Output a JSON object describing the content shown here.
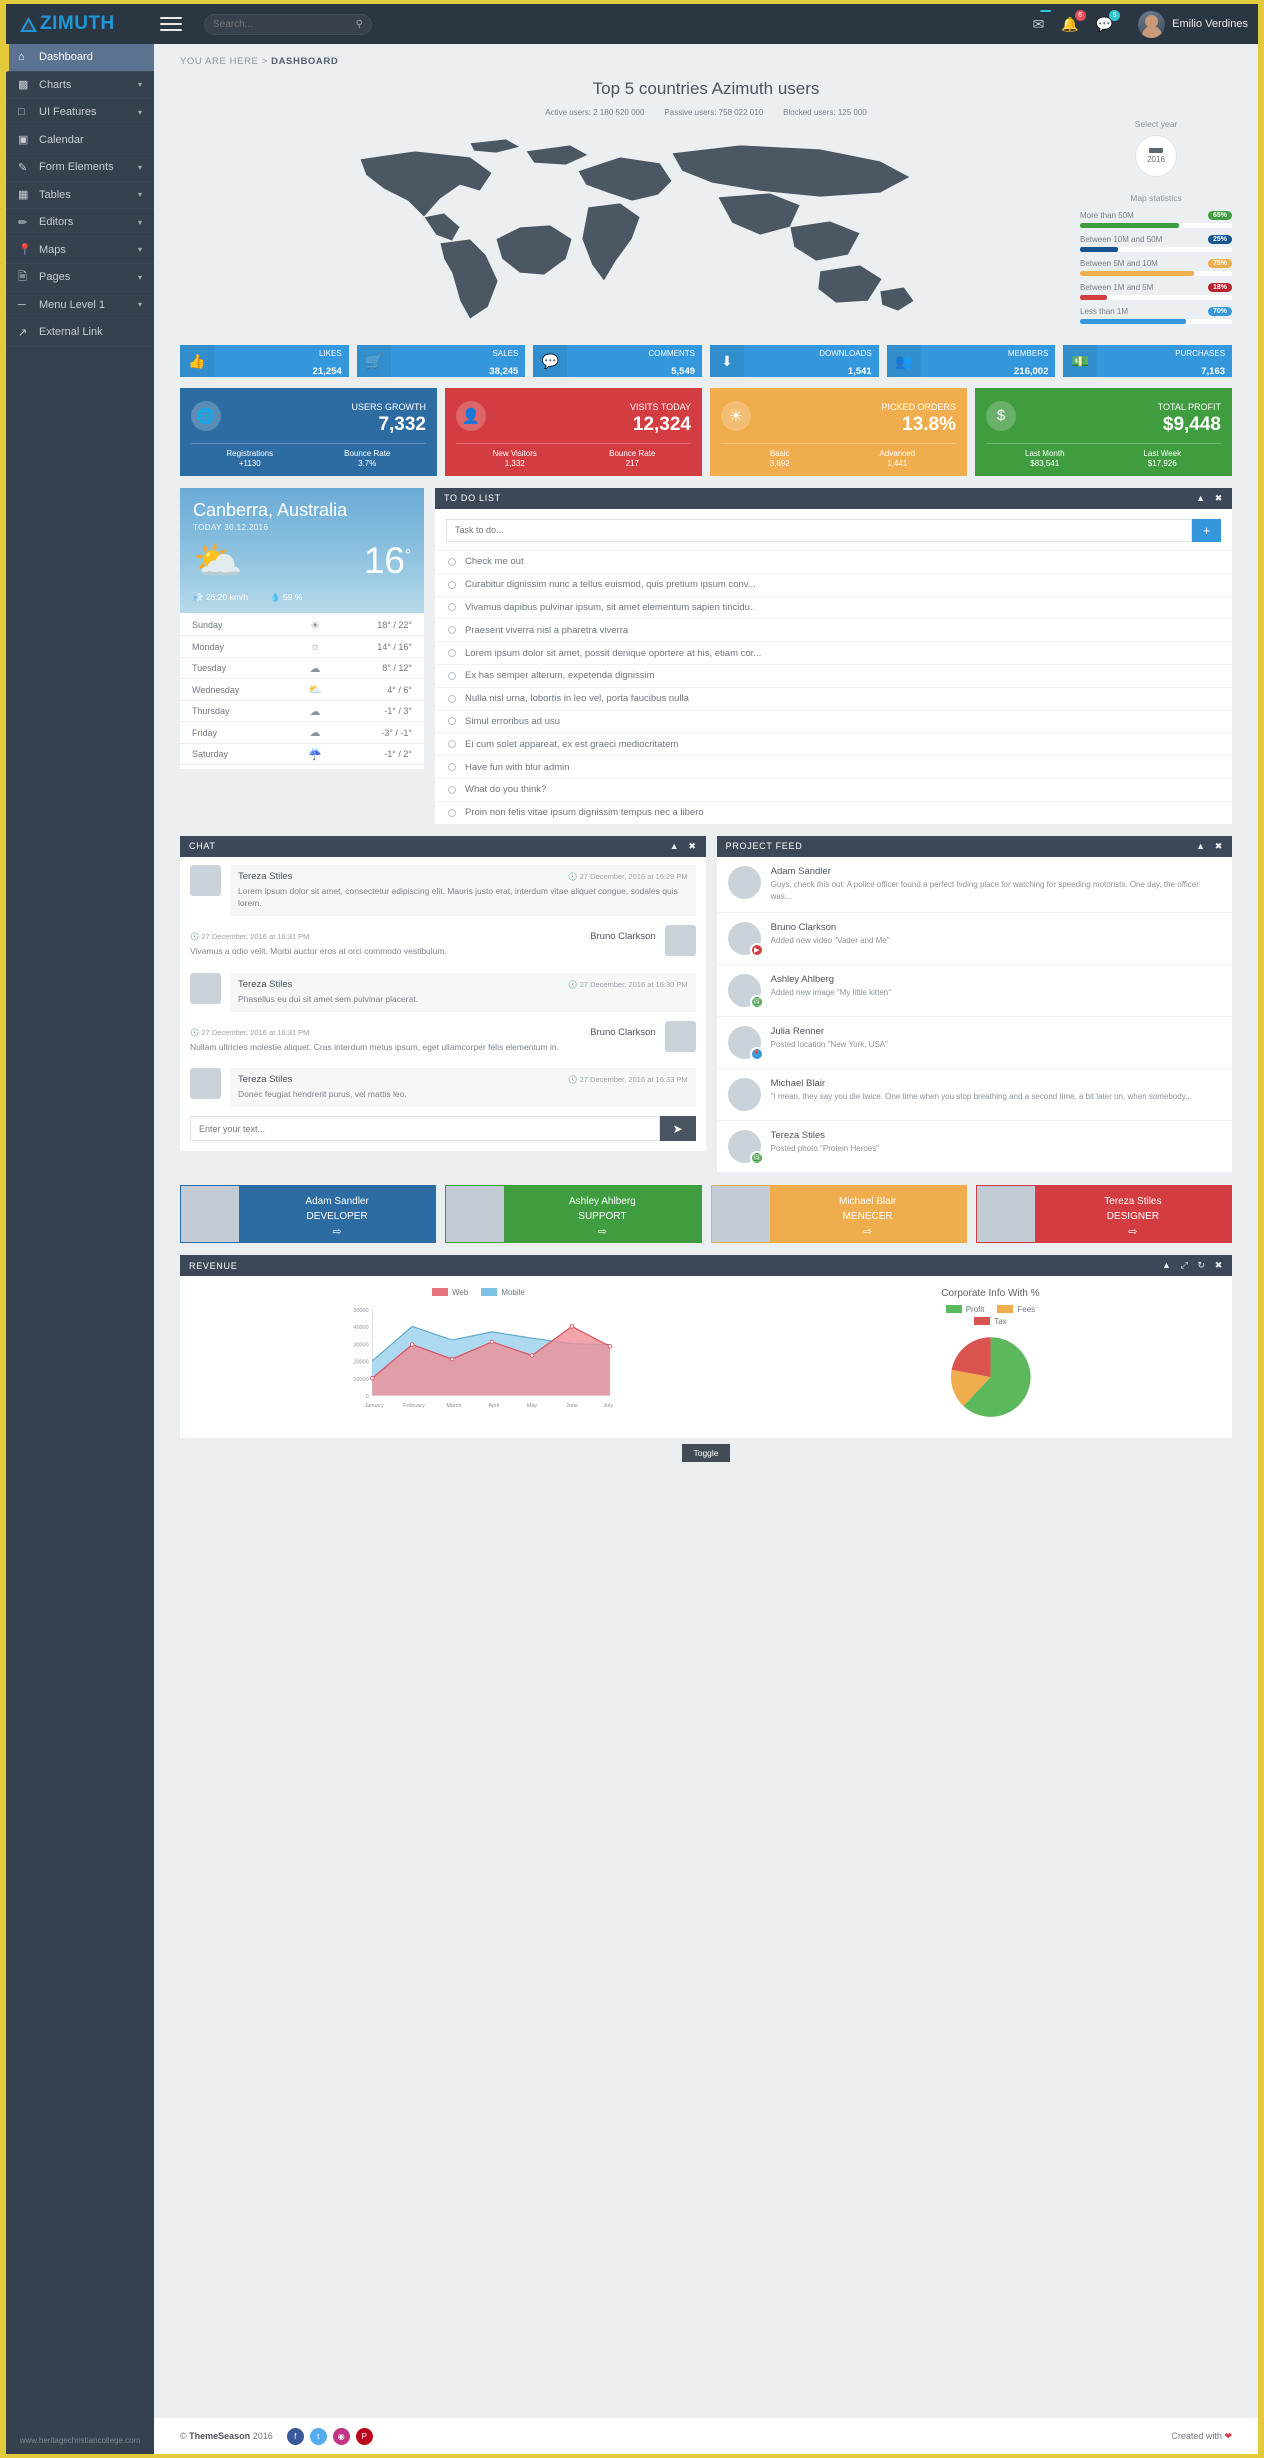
{
  "topbar": {
    "logo_text": "ZIMUTH",
    "search_placeholder": "Search...",
    "user_name": "Emilio Verdines",
    "badges": {
      "mail": "",
      "bell": "6",
      "chat": "5"
    }
  },
  "sidebar": {
    "items": [
      {
        "label": "Dashboard",
        "icon": "home-icon",
        "caret": "",
        "active": true
      },
      {
        "label": "Charts",
        "icon": "bar-chart-icon",
        "caret": "⌄"
      },
      {
        "label": "UI Features",
        "icon": "square-icon",
        "caret": "⌄"
      },
      {
        "label": "Calendar",
        "icon": "calendar-icon",
        "caret": ""
      },
      {
        "label": "Form Elements",
        "icon": "edit-square-icon",
        "caret": "⌄"
      },
      {
        "label": "Tables",
        "icon": "grid-icon",
        "caret": "⌄"
      },
      {
        "label": "Editors",
        "icon": "pencil-icon",
        "caret": "⌄"
      },
      {
        "label": "Maps",
        "icon": "map-pin-icon",
        "caret": "⌄"
      },
      {
        "label": "Pages",
        "icon": "page-icon",
        "caret": "⌄"
      },
      {
        "label": "Menu Level 1",
        "icon": "dash-icon",
        "caret": "⌄"
      },
      {
        "label": "External Link",
        "icon": "external-link-icon",
        "caret": ""
      }
    ],
    "footer": "www.heritagechristiancollege.com"
  },
  "breadcrumb": {
    "prefix": "YOU ARE HERE",
    "sep": ">",
    "current": "DASHBOARD"
  },
  "map": {
    "title": "Top 5 countries Azimuth users",
    "legend": [
      {
        "label": "Active users: 2 180 520 000"
      },
      {
        "label": "Passive users: 758 022 010"
      },
      {
        "label": "Blocked users: 125 000"
      }
    ],
    "select_year_label": "Select year",
    "year": "2016",
    "stats_title": "Map statistics",
    "stats": [
      {
        "label": "More than 50M",
        "pct": "65%",
        "value": 65,
        "color": "#3f9c3f"
      },
      {
        "label": "Between 10M and 50M",
        "pct": "25%",
        "value": 25,
        "color": "#16558f"
      },
      {
        "label": "Between 5M and 10M",
        "pct": "75%",
        "value": 75,
        "color": "#f0ad4e"
      },
      {
        "label": "Between 1M and 5M",
        "pct": "18%",
        "value": 18,
        "color": "#d33c41"
      },
      {
        "label": "Less than 1M",
        "pct": "70%",
        "value": 70,
        "color": "#3598dc"
      }
    ]
  },
  "mini_stats": [
    {
      "label": "LIKES",
      "value": "21,254",
      "icon": "👍"
    },
    {
      "label": "SALES",
      "value": "38,245",
      "icon": "🛒"
    },
    {
      "label": "COMMENTS",
      "value": "5,549",
      "icon": "💬"
    },
    {
      "label": "DOWNLOADS",
      "value": "1,541",
      "icon": "⬇"
    },
    {
      "label": "MEMBERS",
      "value": "216,002",
      "icon": "👥"
    },
    {
      "label": "PURCHASES",
      "value": "7,163",
      "icon": "💵"
    }
  ],
  "big_stats": [
    {
      "color": "blue",
      "icon": "🌐",
      "label": "USERS GROWTH",
      "value": "7,332",
      "foot": [
        {
          "t": "Registrations",
          "v": "+1130"
        },
        {
          "t": "Bounce Rate",
          "v": "3.7%"
        }
      ]
    },
    {
      "color": "red",
      "icon": "👤",
      "label": "VISITS TODAY",
      "value": "12,324",
      "foot": [
        {
          "t": "New Visitors",
          "v": "1,332"
        },
        {
          "t": "Bounce Rate",
          "v": "217"
        }
      ]
    },
    {
      "color": "orange",
      "icon": "☀",
      "label": "PICKED ORDERS",
      "value": "13.8%",
      "foot": [
        {
          "t": "Basic",
          "v": "3,692"
        },
        {
          "t": "Advanced",
          "v": "1,441"
        }
      ]
    },
    {
      "color": "green",
      "icon": "$",
      "label": "TOTAL PROFIT",
      "value": "$9,448",
      "foot": [
        {
          "t": "Last Month",
          "v": "$83,541"
        },
        {
          "t": "Last Week",
          "v": "$17,926"
        }
      ]
    }
  ],
  "weather": {
    "city": "Canberra, Australia",
    "date": "TODAY 30.12.2016",
    "temp": "16",
    "deg": "°",
    "wind": "26.20 km/h",
    "humidity": "59 %",
    "days": [
      {
        "name": "Sunday",
        "icon": "☀",
        "temp": "18° / 22°"
      },
      {
        "name": "Monday",
        "icon": "☼",
        "temp": "14° / 16°"
      },
      {
        "name": "Tuesday",
        "icon": "☁",
        "temp": "8° / 12°"
      },
      {
        "name": "Wednesday",
        "icon": "⛅",
        "temp": "4° / 6°"
      },
      {
        "name": "Thursday",
        "icon": "☁",
        "temp": "-1° / 3°"
      },
      {
        "name": "Friday",
        "icon": "☁",
        "temp": "-3° / -1°"
      },
      {
        "name": "Saturday",
        "icon": "☔",
        "temp": "-1° / 2°"
      }
    ]
  },
  "todo": {
    "title": "TO DO LIST",
    "placeholder": "Task to do...",
    "add_label": "+",
    "items": [
      "Check me out",
      "Curabitur dignissim nunc a tellus euismod, quis pretium ipsum conv...",
      "Vivamus dapibus pulvinar ipsum, sit amet elementum sapien tincidu..",
      "Praesent viverra nisl a pharetra viverra",
      "Lorem ipsum dolor sit amet, possit denique oportere at his, etiam cor...",
      "Ex has semper alterum, expetenda dignissim",
      "Nulla nisl urna, lobortis in leo vel, porta faucibus nulla",
      "Simul erroribus ad usu",
      "Ei cum solet appareat, ex est graeci mediocritatem",
      "Have fun with blur admin",
      "What do you think?",
      "Proin non felis vitae ipsum dignissim tempus nec a libero"
    ]
  },
  "chat": {
    "title": "CHAT",
    "placeholder": "Enter your text...",
    "messages": [
      {
        "name": "Tereza Stiles",
        "time": "27 December, 2016 at 16:28 PM",
        "out": false,
        "text": "Lorem ipsum dolor sit amet, consectetur adipiscing elit. Mauris justo erat, interdum vitae aliquet congue, sodales quis lorem."
      },
      {
        "name": "Bruno Clarkson",
        "time": "27 December, 2016 at 16:31 PM",
        "out": true,
        "text": "Vivamus a odio velit. Morbi auctor eros at orci commodo vestibulum."
      },
      {
        "name": "Tereza Stiles",
        "time": "27 December, 2016 at 16:30 PM",
        "out": false,
        "text": "Phasellus eu dui sit amet sem pulvinar placerat."
      },
      {
        "name": "Bruno Clarkson",
        "time": "27 December, 2016 at 16:31 PM",
        "out": true,
        "text": "Nullam ultricies molestie aliquet. Cras interdum metus ipsum, eget ullamcorper felis elementum in."
      },
      {
        "name": "Tereza Stiles",
        "time": "27 December, 2016 at 16:33 PM",
        "out": false,
        "text": "Donec feugiat hendrerit purus, vel mattis leo."
      }
    ]
  },
  "feed": {
    "title": "PROJECT FEED",
    "items": [
      {
        "name": "Adam Sandler",
        "text": "Guys, check this out: A police officer found a perfect hiding place for watching for speeding motorists. One day, the officer was...",
        "badge": "",
        "badge_color": ""
      },
      {
        "name": "Bruno Clarkson",
        "text": "Added new video \"Vader and Me\"",
        "badge": "▶",
        "badge_color": "#d33c41"
      },
      {
        "name": "Ashley Ahlberg",
        "text": "Added new image \"My little kitten\"",
        "badge": "🖼",
        "badge_color": "#3f9c3f"
      },
      {
        "name": "Julia Renner",
        "text": "Posted location \"New York, USA\"",
        "badge": "📍",
        "badge_color": "#3598dc"
      },
      {
        "name": "Michael Blair",
        "text": "\"I mean, they say you die twice. One time when you stop breathing and a second time, a bit later on, when somebody...",
        "badge": "",
        "badge_color": ""
      },
      {
        "name": "Tereza Stiles",
        "text": "Posted photo \"Protein Heroes\"",
        "badge": "🖼",
        "badge_color": "#3f9c3f"
      }
    ]
  },
  "tiles": [
    {
      "name": "Adam Sandler",
      "role": "DEVELOPER",
      "color": "blue",
      "arrow": "→"
    },
    {
      "name": "Ashley Ahlberg",
      "role": "SUPPORT",
      "color": "green",
      "arrow": "→"
    },
    {
      "name": "Michael Blair",
      "role": "MENECER",
      "color": "orange",
      "arrow": "→"
    },
    {
      "name": "Tereza Stiles",
      "role": "DESIGNER",
      "color": "red",
      "arrow": "→"
    }
  ],
  "revenue": {
    "title": "REVENUE",
    "toggle_label": "Toggle",
    "pie_title": "Corporate Info With %"
  },
  "chart_data": [
    {
      "type": "area",
      "title": "Revenue",
      "categories": [
        "January",
        "February",
        "March",
        "April",
        "May",
        "June",
        "July"
      ],
      "series": [
        {
          "name": "Web",
          "color": "#e7737d",
          "values": [
            10000,
            29000,
            21000,
            31000,
            23000,
            40000,
            28000
          ]
        },
        {
          "name": "Mobile",
          "color": "#7dc3e8",
          "values": [
            20000,
            41000,
            33000,
            38000,
            34000,
            31000,
            30000
          ]
        }
      ],
      "ylim": [
        0,
        50000
      ],
      "yticks": [
        0,
        10000,
        20000,
        30000,
        40000,
        50000
      ],
      "ylabel": "",
      "xlabel": "",
      "grid": false,
      "legend_position": "top"
    },
    {
      "type": "pie",
      "title": "Corporate Info With %",
      "labels": [
        "Profit",
        "Fees",
        "Tax"
      ],
      "values": [
        55,
        18,
        27
      ],
      "colors": [
        "#5cb85c",
        "#f0ad4e",
        "#d9534f"
      ],
      "legend_position": "top"
    }
  ],
  "footer": {
    "copyright_brand": "ThemeSeason",
    "copyright_year": "2016",
    "copyright_mark": "©",
    "created_with": "Created with",
    "heart": "❤",
    "socials": [
      {
        "name": "facebook-icon",
        "glyph": "f",
        "color": "#3b5998"
      },
      {
        "name": "twitter-icon",
        "glyph": "t",
        "color": "#55acee"
      },
      {
        "name": "instagram-icon",
        "glyph": "◉",
        "color": "#c13584"
      },
      {
        "name": "pinterest-icon",
        "glyph": "P",
        "color": "#bd081c"
      }
    ]
  }
}
